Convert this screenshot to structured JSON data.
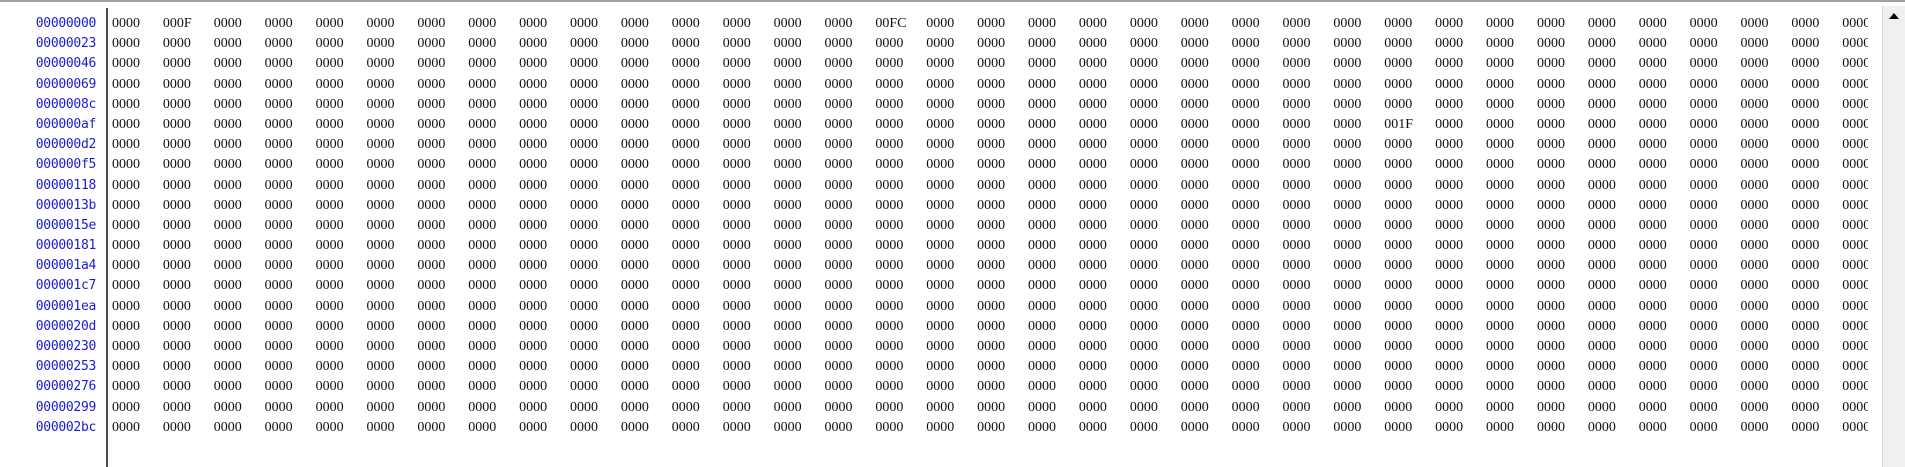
{
  "hex_view": {
    "addresses": [
      "00000000",
      "00000023",
      "00000046",
      "00000069",
      "0000008c",
      "000000af",
      "000000d2",
      "000000f5",
      "00000118",
      "0000013b",
      "0000015e",
      "00000181",
      "000001a4",
      "000001c7",
      "000001ea",
      "0000020d",
      "00000230",
      "00000253",
      "00000276",
      "00000299",
      "000002bc"
    ],
    "words_per_row": 35,
    "default_word": "0000",
    "special_words": [
      {
        "row": 0,
        "col": 1,
        "value": "000F"
      },
      {
        "row": 0,
        "col": 15,
        "value": "00FC"
      },
      {
        "row": 5,
        "col": 25,
        "value": "001F"
      }
    ]
  },
  "colors": {
    "address": "#1a1ad6",
    "data": "#111111",
    "divider": "#4a4a4a"
  },
  "scrollbar": {
    "up_icon": "triangle-up-icon"
  }
}
